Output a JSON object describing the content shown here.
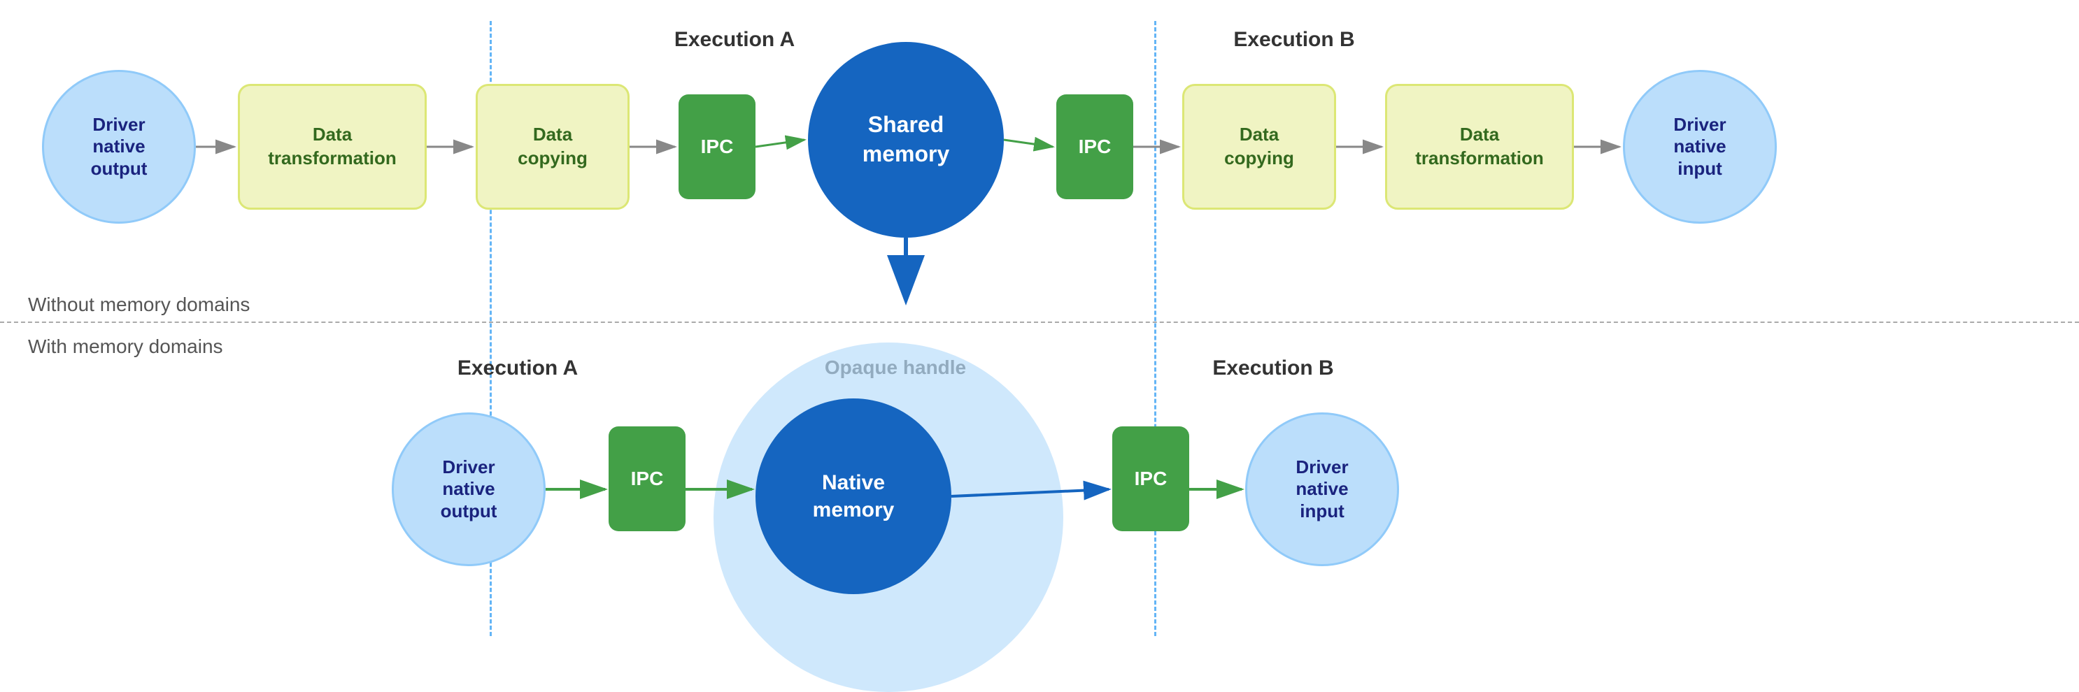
{
  "sections": {
    "without": "Without memory domains",
    "with": "With memory domains"
  },
  "top_row": {
    "exec_a": "Execution A",
    "exec_b": "Execution B",
    "nodes": [
      {
        "id": "driver-native-output-top",
        "type": "circle",
        "label": "Driver\nnative\noutput"
      },
      {
        "id": "data-transform-left",
        "type": "rect",
        "label": "Data\ntransformation"
      },
      {
        "id": "data-copying-left",
        "type": "rect",
        "label": "Data\ncopying"
      },
      {
        "id": "ipc-left",
        "type": "ipc",
        "label": "IPC"
      },
      {
        "id": "shared-memory",
        "type": "shared",
        "label": "Shared\nmemory"
      },
      {
        "id": "ipc-right",
        "type": "ipc",
        "label": "IPC"
      },
      {
        "id": "data-copying-right",
        "type": "rect",
        "label": "Data\ncopying"
      },
      {
        "id": "data-transform-right",
        "type": "rect",
        "label": "Data\ntransformation"
      },
      {
        "id": "driver-native-input-top",
        "type": "circle",
        "label": "Driver\nnative\ninput"
      }
    ]
  },
  "bottom_row": {
    "exec_a": "Execution A",
    "exec_b": "Execution B",
    "opaque_label": "Opaque handle",
    "nodes": [
      {
        "id": "driver-native-output-bot",
        "type": "circle",
        "label": "Driver\nnative\noutput"
      },
      {
        "id": "ipc-bot-left",
        "type": "ipc",
        "label": "IPC"
      },
      {
        "id": "native-memory",
        "type": "native",
        "label": "Native\nmemory"
      },
      {
        "id": "ipc-bot-right",
        "type": "ipc",
        "label": "IPC"
      },
      {
        "id": "driver-native-input-bot",
        "type": "circle",
        "label": "Driver\nnative\ninput"
      }
    ]
  }
}
